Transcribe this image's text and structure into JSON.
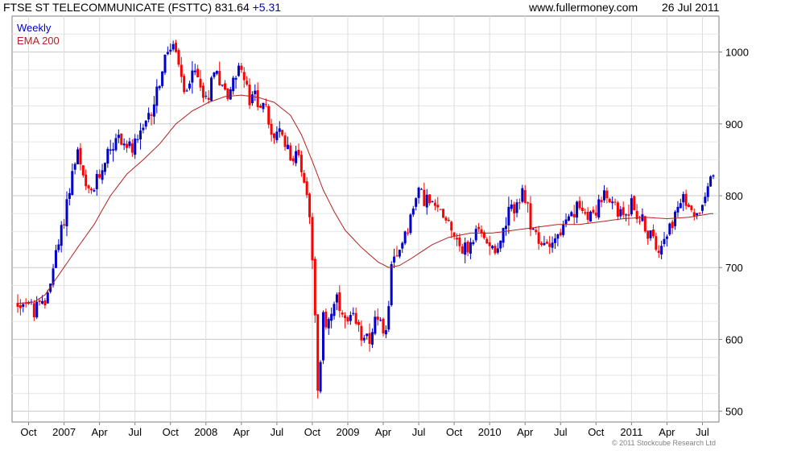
{
  "header": {
    "title": "FTSE ST TELECOMMUNICATE (FSTTC)",
    "last": "831.64",
    "change": "+5.31",
    "site": "www.fullermoney.com",
    "date": "26 Jul 2011"
  },
  "legend": {
    "weekly": "Weekly",
    "ema": "EMA 200"
  },
  "copyright": "© 2011 Stockcube Research Ltd",
  "chart_data": {
    "type": "candlestick",
    "title": "FTSE ST TELECOMMUNICATE (FSTTC)",
    "period": "Weekly",
    "ylim": [
      485,
      1050
    ],
    "y_ticks": [
      500,
      600,
      700,
      800,
      900,
      1000
    ],
    "x_ticks": [
      {
        "label": "Oct",
        "i": 4
      },
      {
        "label": "2007",
        "i": 17
      },
      {
        "label": "Apr",
        "i": 30
      },
      {
        "label": "Jul",
        "i": 43
      },
      {
        "label": "Oct",
        "i": 56
      },
      {
        "label": "2008",
        "i": 69
      },
      {
        "label": "Apr",
        "i": 82
      },
      {
        "label": "Jul",
        "i": 95
      },
      {
        "label": "Oct",
        "i": 108
      },
      {
        "label": "2009",
        "i": 121
      },
      {
        "label": "Apr",
        "i": 134
      },
      {
        "label": "Jul",
        "i": 147
      },
      {
        "label": "Oct",
        "i": 160
      },
      {
        "label": "2010",
        "i": 173
      },
      {
        "label": "Apr",
        "i": 186
      },
      {
        "label": "Jul",
        "i": 199
      },
      {
        "label": "Oct",
        "i": 212
      },
      {
        "label": "2011",
        "i": 225
      },
      {
        "label": "Apr",
        "i": 238
      },
      {
        "label": "Jul",
        "i": 251
      }
    ],
    "grid": true,
    "y_axis_side": "right",
    "series": [
      {
        "name": "Weekly",
        "up_color": "#0000cc",
        "down_color": "#ff0000",
        "keypoints": [
          [
            0,
            650
          ],
          [
            3,
            655
          ],
          [
            6,
            640
          ],
          [
            10,
            650
          ],
          [
            13,
            700
          ],
          [
            16,
            750
          ],
          [
            18,
            790
          ],
          [
            20,
            830
          ],
          [
            22,
            860
          ],
          [
            24,
            820
          ],
          [
            26,
            800
          ],
          [
            28,
            810
          ],
          [
            31,
            840
          ],
          [
            34,
            870
          ],
          [
            37,
            880
          ],
          [
            40,
            870
          ],
          [
            43,
            865
          ],
          [
            46,
            890
          ],
          [
            49,
            920
          ],
          [
            52,
            960
          ],
          [
            55,
            1000
          ],
          [
            57,
            1010
          ],
          [
            59,
            980
          ],
          [
            61,
            940
          ],
          [
            63,
            960
          ],
          [
            65,
            970
          ],
          [
            67,
            960
          ],
          [
            69,
            930
          ],
          [
            71,
            960
          ],
          [
            73,
            980
          ],
          [
            75,
            950
          ],
          [
            77,
            940
          ],
          [
            79,
            960
          ],
          [
            81,
            985
          ],
          [
            83,
            960
          ],
          [
            85,
            930
          ],
          [
            87,
            940
          ],
          [
            89,
            930
          ],
          [
            91,
            920
          ],
          [
            93,
            880
          ],
          [
            95,
            890
          ],
          [
            97,
            880
          ],
          [
            99,
            870
          ],
          [
            101,
            850
          ],
          [
            103,
            860
          ],
          [
            105,
            820
          ],
          [
            107,
            780
          ],
          [
            108,
            720
          ],
          [
            109,
            640
          ],
          [
            110,
            520
          ],
          [
            111,
            560
          ],
          [
            112,
            640
          ],
          [
            113,
            620
          ],
          [
            115,
            640
          ],
          [
            117,
            650
          ],
          [
            119,
            630
          ],
          [
            121,
            620
          ],
          [
            123,
            625
          ],
          [
            125,
            610
          ],
          [
            127,
            610
          ],
          [
            129,
            605
          ],
          [
            131,
            625
          ],
          [
            133,
            615
          ],
          [
            135,
            610
          ],
          [
            137,
            700
          ],
          [
            139,
            710
          ],
          [
            141,
            740
          ],
          [
            143,
            760
          ],
          [
            145,
            780
          ],
          [
            147,
            810
          ],
          [
            149,
            800
          ],
          [
            151,
            790
          ],
          [
            153,
            780
          ],
          [
            155,
            780
          ],
          [
            157,
            770
          ],
          [
            159,
            760
          ],
          [
            161,
            740
          ],
          [
            163,
            725
          ],
          [
            165,
            725
          ],
          [
            167,
            740
          ],
          [
            169,
            750
          ],
          [
            171,
            740
          ],
          [
            173,
            740
          ],
          [
            175,
            725
          ],
          [
            177,
            740
          ],
          [
            179,
            760
          ],
          [
            181,
            780
          ],
          [
            183,
            790
          ],
          [
            185,
            800
          ],
          [
            187,
            775
          ],
          [
            189,
            755
          ],
          [
            191,
            730
          ],
          [
            193,
            730
          ],
          [
            195,
            740
          ],
          [
            197,
            740
          ],
          [
            199,
            750
          ],
          [
            201,
            760
          ],
          [
            203,
            770
          ],
          [
            205,
            780
          ],
          [
            207,
            780
          ],
          [
            209,
            780
          ],
          [
            211,
            775
          ],
          [
            213,
            790
          ],
          [
            215,
            800
          ],
          [
            217,
            785
          ],
          [
            219,
            790
          ],
          [
            221,
            770
          ],
          [
            223,
            780
          ],
          [
            225,
            790
          ],
          [
            227,
            775
          ],
          [
            229,
            760
          ],
          [
            231,
            750
          ],
          [
            233,
            735
          ],
          [
            235,
            730
          ],
          [
            237,
            750
          ],
          [
            239,
            760
          ],
          [
            241,
            770
          ],
          [
            243,
            790
          ],
          [
            245,
            790
          ],
          [
            247,
            785
          ],
          [
            249,
            770
          ],
          [
            251,
            795
          ],
          [
            253,
            815
          ],
          [
            254,
            830
          ]
        ]
      },
      {
        "name": "EMA 200",
        "color": "#b22222",
        "keypoints": [
          [
            0,
            650
          ],
          [
            6,
            652
          ],
          [
            10,
            662
          ],
          [
            16,
            695
          ],
          [
            22,
            728
          ],
          [
            28,
            760
          ],
          [
            34,
            800
          ],
          [
            40,
            830
          ],
          [
            46,
            850
          ],
          [
            52,
            872
          ],
          [
            58,
            900
          ],
          [
            64,
            918
          ],
          [
            70,
            930
          ],
          [
            76,
            938
          ],
          [
            82,
            940
          ],
          [
            88,
            937
          ],
          [
            94,
            930
          ],
          [
            100,
            912
          ],
          [
            104,
            885
          ],
          [
            108,
            848
          ],
          [
            112,
            808
          ],
          [
            116,
            778
          ],
          [
            120,
            752
          ],
          [
            126,
            728
          ],
          [
            132,
            708
          ],
          [
            136,
            700
          ],
          [
            140,
            703
          ],
          [
            144,
            712
          ],
          [
            148,
            722
          ],
          [
            152,
            732
          ],
          [
            158,
            742
          ],
          [
            166,
            748
          ],
          [
            174,
            748
          ],
          [
            182,
            752
          ],
          [
            190,
            756
          ],
          [
            198,
            760
          ],
          [
            206,
            760
          ],
          [
            214,
            764
          ],
          [
            222,
            768
          ],
          [
            230,
            770
          ],
          [
            238,
            768
          ],
          [
            246,
            770
          ],
          [
            254,
            775
          ]
        ]
      }
    ]
  }
}
